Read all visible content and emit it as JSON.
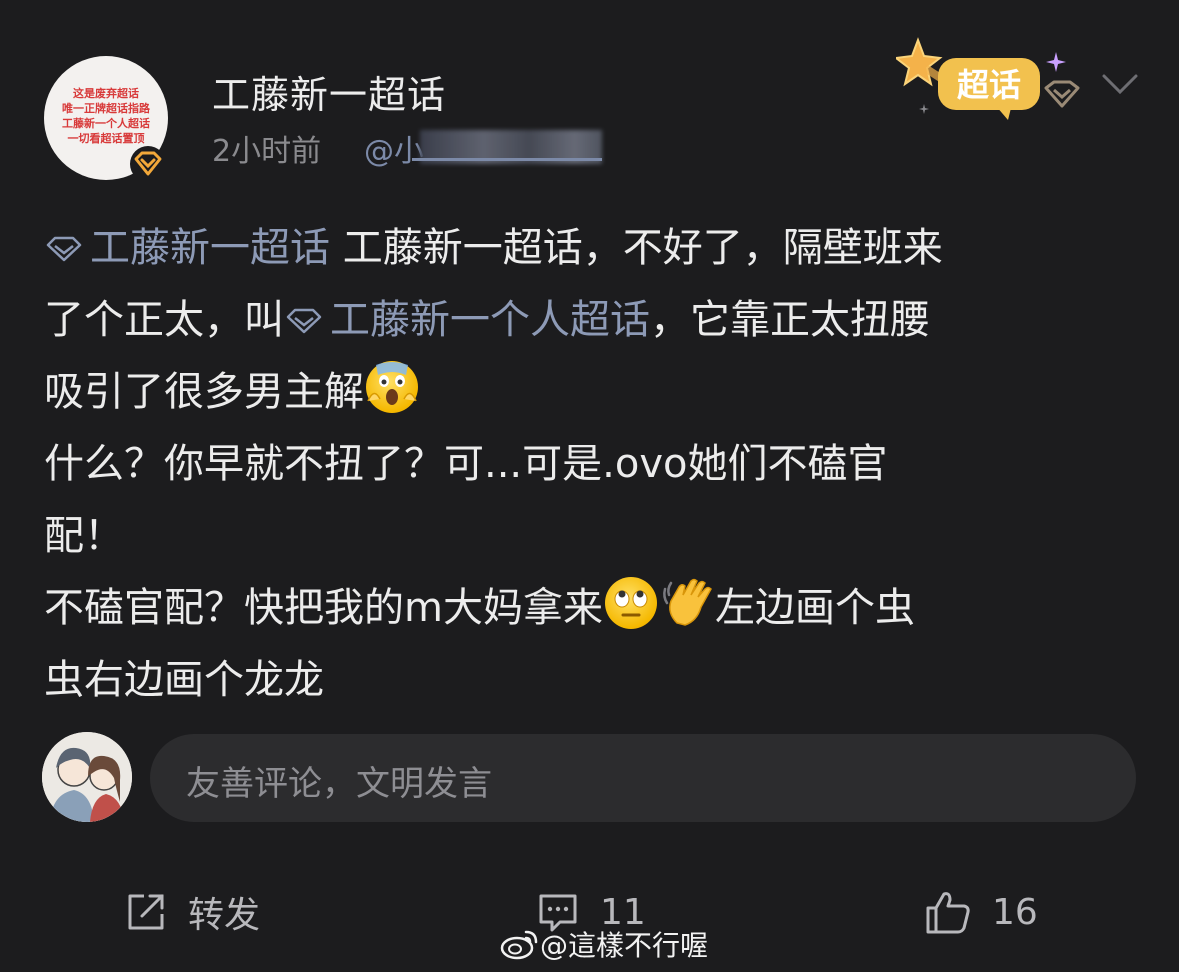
{
  "header": {
    "avatar_lines": [
      "这是废弃超话",
      "唯一正牌超话指路",
      "工藤新一个人超话",
      "一切看超话置顶"
    ],
    "title": "工藤新一超话",
    "time": "2小时前",
    "mention": "@小",
    "badge_label": "超话"
  },
  "post": {
    "line1_link": "工藤新一超话",
    "line1_text": " 工藤新一超话，不好了，隔壁班来",
    "line2_text": "了个正太，叫",
    "line2_link": "工藤新一个人超话",
    "line2_tail": "，它靠正太扭腰",
    "line3_text": "吸引了很多男主解",
    "line4_text": "什么？你早就不扭了？可...可是.ovo她们不磕官",
    "line5_text": "配！",
    "line6_text": "不磕官配？快把我的m大妈拿来",
    "line6_tail": "左边画个虫",
    "line7_text": "虫右边画个龙龙",
    "emoji": [
      "scream-emoji",
      "eye-roll-emoji",
      "waving-hand-emoji"
    ]
  },
  "comment": {
    "placeholder": "友善评论，文明发言"
  },
  "actions": {
    "repost_label": "转发",
    "comment_count": "11",
    "like_count": "16"
  },
  "watermark": "@這樣不行喔",
  "colors": {
    "background": "#1c1c1e",
    "link": "#8d9ab6",
    "badge_gold": "#f2c14e"
  }
}
